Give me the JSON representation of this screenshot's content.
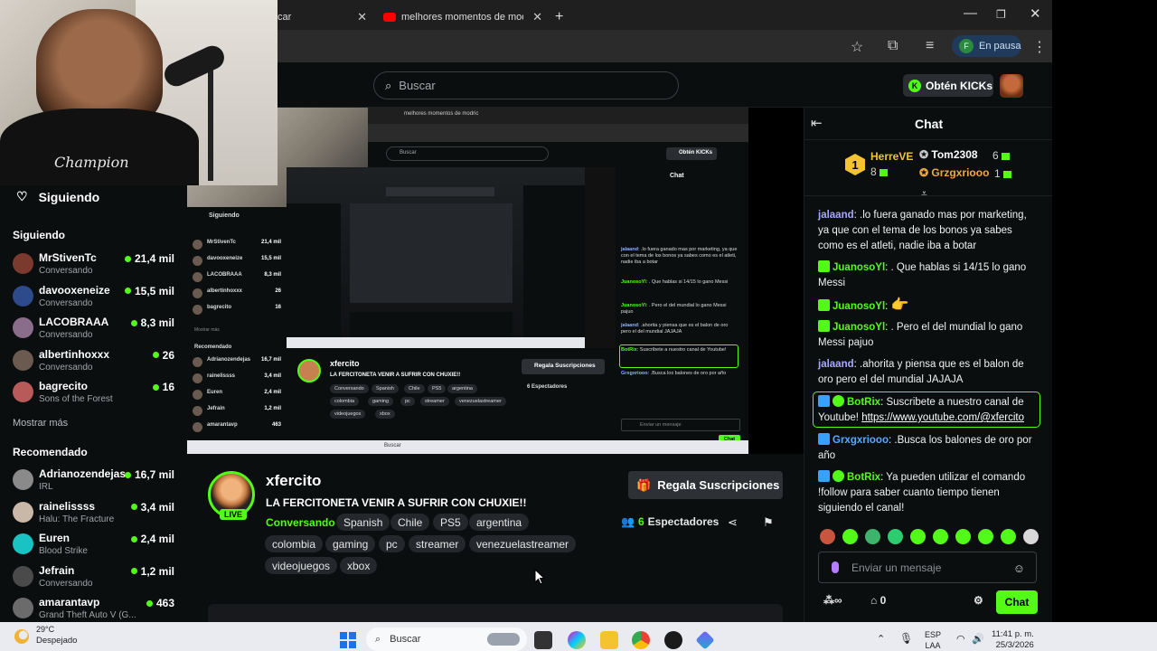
{
  "browser": {
    "tabs": [
      {
        "label": "car",
        "active": false
      },
      {
        "label": "melhores momentos de modric",
        "active": false
      }
    ],
    "new_tab": "+",
    "profile_label": "En pausa",
    "profile_initial": "F"
  },
  "header": {
    "search_placeholder": "Buscar",
    "kicks_label": "Obtén KICKs"
  },
  "sidebar": {
    "following_header": "Siguiendo",
    "following_section": "Siguiendo",
    "following": [
      {
        "name": "MrStivenTc",
        "category": "Conversando",
        "viewers": "21,4 mil",
        "color": "#7a3b2e"
      },
      {
        "name": "davooxeneize",
        "category": "Conversando",
        "viewers": "15,5 mil",
        "color": "#2d4a8a"
      },
      {
        "name": "LACOBRAAA",
        "category": "Conversando",
        "viewers": "8,3 mil",
        "color": "#8a6d8a"
      },
      {
        "name": "albertinhoxxx",
        "category": "Conversando",
        "viewers": "26",
        "color": "#6b5a4f"
      },
      {
        "name": "bagrecito",
        "category": "Sons of the Forest",
        "viewers": "16",
        "color": "#b85a5a"
      }
    ],
    "show_more": "Mostrar más",
    "recommended_section": "Recomendado",
    "recommended": [
      {
        "name": "Adrianozendejas",
        "category": "IRL",
        "viewers": "16,7 mil",
        "color": "#8a8a8a"
      },
      {
        "name": "rainelissss",
        "category": "Halu: The Fracture",
        "viewers": "3,4 mil",
        "color": "#c9b8a8"
      },
      {
        "name": "Euren",
        "category": "Blood Strike",
        "viewers": "2,4 mil",
        "color": "#19c3c3"
      },
      {
        "name": "Jefrain",
        "category": "Conversando",
        "viewers": "1,2 mil",
        "color": "#4a4a4a"
      },
      {
        "name": "amarantavp",
        "category": "Grand Theft Auto V (G...",
        "viewers": "463",
        "color": "#6b6b6b"
      }
    ]
  },
  "nested": {
    "tab": "melhores momentos de modric",
    "search": "Buscar",
    "kicks": "Obtén KICKs",
    "following": "Siguiendo",
    "chat_title": "Chat",
    "channel": "xfercito",
    "stream_title": "LA FERCITONETA VENIR A SUFRIR CON CHUXIE!!",
    "gift": "Regala Suscripciones",
    "viewers": "6 Espectadores",
    "input": "Enviar un mensaje",
    "send": "Chat",
    "search_task": "Buscar"
  },
  "stream": {
    "channel": "xfercito",
    "live_badge": "LIVE",
    "title": "LA FERCITONETA VENIR A SUFRIR CON CHUXIE!!",
    "category": "Conversando",
    "tags_row1": [
      "Spanish",
      "Chile",
      "PS5",
      "argentina"
    ],
    "tags_row2": [
      "colombia",
      "gaming",
      "pc",
      "streamer",
      "venezuelastreamer"
    ],
    "tags_row3": [
      "videojuegos",
      "xbox"
    ],
    "gift_label": "Regala Suscripciones",
    "viewers_count": "6",
    "viewers_label": "Espectadores"
  },
  "chat": {
    "title": "Chat",
    "pinned": {
      "top_rank": "1",
      "top_user": "HerreVE",
      "top_count": "8",
      "user2": "Tom2308",
      "user2_count": "6",
      "user3": "Grzgxriooo",
      "user3_count": "1"
    },
    "messages": [
      {
        "user": "jalaand",
        "color": "ub",
        "text": ".lo fuera ganado mas por marketing, ya que con el tema de los bonos ya sabes como es el atleti, nadie iba a botar"
      },
      {
        "user": "JuanosoYl",
        "color": "ug",
        "text": ". Que hablas si 14/15 lo gano Messi"
      },
      {
        "user": "JuanosoYl",
        "color": "ug",
        "text": ""
      },
      {
        "user": "JuanosoYl",
        "color": "ug",
        "text": ". Pero el del mundial lo gano Messi pajuo"
      },
      {
        "user": "jalaand",
        "color": "ub",
        "text": ".ahorita y piensa que es el balon de oro pero el del mundial JAJAJA"
      },
      {
        "user": "BotRix",
        "color": "ug",
        "text": "Suscribete a nuestro canal de Youtube!",
        "link": "https://www.youtube.com/@xfercito"
      },
      {
        "user": "Grxgxriooo",
        "color": "ubl",
        "text": ".Busca los balones de oro por año"
      },
      {
        "user": "BotRix",
        "color": "ug",
        "text": "Ya pueden utilizar el comando !follow para saber cuanto tiempo tienen siguiendo el canal!"
      }
    ],
    "input_placeholder": "Enviar un mensaje",
    "points": "0",
    "send_label": "Chat"
  },
  "taskbar": {
    "temperature": "29°C",
    "weather": "Despejado",
    "search_label": "Buscar",
    "lang_top": "ESP",
    "lang_bottom": "LAA",
    "time": "11:41 p. m.",
    "date": "25/3/2026"
  }
}
